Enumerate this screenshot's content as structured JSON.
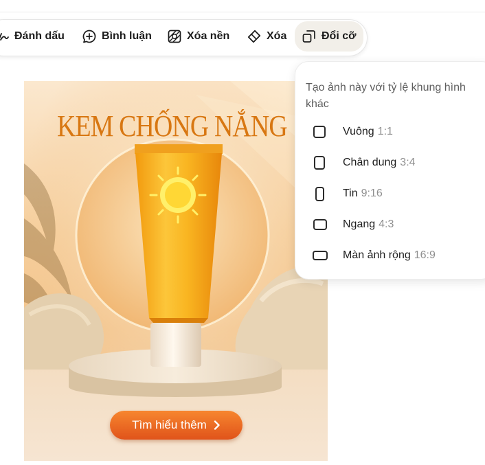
{
  "toolbar": {
    "mark_label": "Đánh dấu",
    "comment_label": "Bình luận",
    "remove_bg_label": "Xóa nền",
    "erase_label": "Xóa",
    "resize_label": "Đổi cỡ"
  },
  "image": {
    "title": "KEM CHỐNG NẮNG",
    "cta_label": "Tìm hiểu thêm"
  },
  "resize_menu": {
    "heading": "Tạo ảnh này với tỷ lệ khung hình khác",
    "options": [
      {
        "label": "Vuông",
        "ratio": "1:1"
      },
      {
        "label": "Chân dung",
        "ratio": "3:4"
      },
      {
        "label": "Tin",
        "ratio": "9:16"
      },
      {
        "label": "Ngang",
        "ratio": "4:3"
      },
      {
        "label": "Màn ảnh rộng",
        "ratio": "16:9"
      }
    ]
  },
  "colors": {
    "title_orange": "#d87712",
    "cta_orange": "#ee6a24",
    "tube_yellow": "#f6b21e",
    "active_tool_bg": "#f2efe9"
  }
}
